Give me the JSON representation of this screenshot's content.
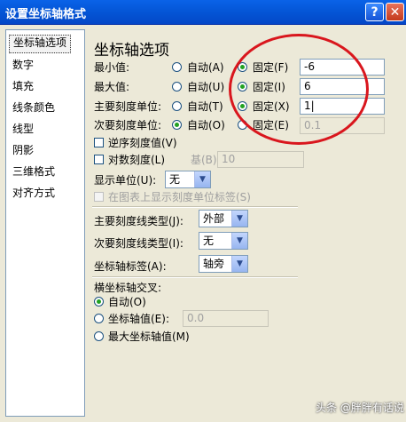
{
  "window": {
    "title": "设置坐标轴格式",
    "help_glyph": "?",
    "close_glyph": "✕"
  },
  "nav": {
    "items": [
      {
        "label": "坐标轴选项",
        "selected": true
      },
      {
        "label": "数字"
      },
      {
        "label": "填充"
      },
      {
        "label": "线条颜色"
      },
      {
        "label": "线型"
      },
      {
        "label": "阴影"
      },
      {
        "label": "三维格式"
      },
      {
        "label": "对齐方式"
      }
    ]
  },
  "axis_options": {
    "heading": "坐标轴选项",
    "rows": [
      {
        "label": "最小值:",
        "auto": "自动(A)",
        "fixed": "固定(F)",
        "selected": "fixed",
        "value": "-6"
      },
      {
        "label": "最大值:",
        "auto": "自动(U)",
        "fixed": "固定(I)",
        "selected": "fixed",
        "value": "6"
      },
      {
        "label": "主要刻度单位:",
        "auto": "自动(T)",
        "fixed": "固定(X)",
        "selected": "fixed",
        "value": "1|"
      },
      {
        "label": "次要刻度单位:",
        "auto": "自动(O)",
        "fixed": "固定(E)",
        "selected": "auto",
        "value": "0.1"
      }
    ],
    "reverse_order": {
      "label": "逆序刻度值(V)",
      "checked": false
    },
    "log_scale": {
      "label": "对数刻度(L)",
      "checked": false,
      "base_label": "基(B):",
      "base_value": "10"
    },
    "display_units": {
      "label": "显示单位(U):",
      "value": "无"
    },
    "show_units_label": {
      "label": "在图表上显示刻度单位标签(S)",
      "checked": false
    },
    "major_tick_type": {
      "label": "主要刻度线类型(J):",
      "value": "外部"
    },
    "minor_tick_type": {
      "label": "次要刻度线类型(I):",
      "value": "无"
    },
    "axis_labels": {
      "label": "坐标轴标签(A):",
      "value": "轴旁"
    },
    "crosses": {
      "label": "横坐标轴交叉:",
      "options": [
        {
          "label": "自动(O)",
          "selected": true
        },
        {
          "label": "坐标轴值(E):",
          "value": "0.0"
        },
        {
          "label": "最大坐标轴值(M)"
        }
      ]
    }
  },
  "watermark": "头条 @胖胖有话说",
  "colors": {
    "titlebar": "#0558d9",
    "annotation_oval": "#d9161d",
    "radio_dot": "#21a121"
  }
}
